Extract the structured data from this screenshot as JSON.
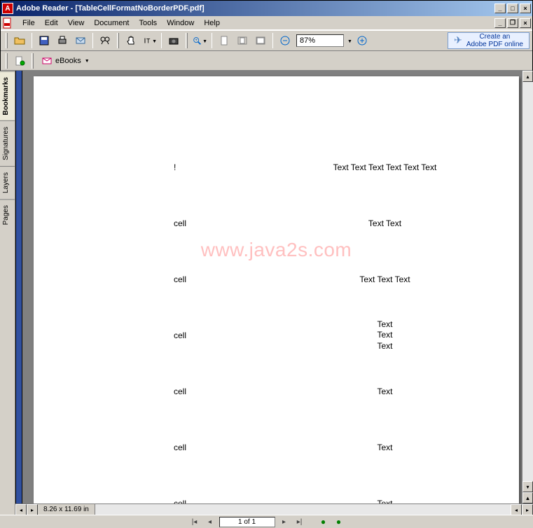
{
  "titlebar": {
    "app_name": "Adobe Reader",
    "doc_name": "[TableCellFormatNoBorderPDF.pdf]"
  },
  "menu": {
    "items": [
      "File",
      "Edit",
      "View",
      "Document",
      "Tools",
      "Window",
      "Help"
    ]
  },
  "toolbar": {
    "zoom_value": "87%",
    "ad_line1": "Create an",
    "ad_line2": "Adobe PDF online",
    "ebooks_label": "eBooks"
  },
  "sidebar": {
    "tabs": [
      "Bookmarks",
      "Signatures",
      "Layers",
      "Pages"
    ],
    "active": 0
  },
  "document": {
    "watermark": "www.java2s.com",
    "rows": [
      {
        "left": "!",
        "right": "Text Text Text Text Text Text"
      },
      {
        "left": "cell",
        "right": "Text Text"
      },
      {
        "left": "cell",
        "right": "Text Text Text"
      },
      {
        "left": "cell",
        "right_lines": [
          "Text",
          "Text",
          "Text"
        ]
      },
      {
        "left": "cell",
        "right": "Text"
      },
      {
        "left": "cell",
        "right": "Text"
      },
      {
        "left": "cell",
        "right": "Text"
      }
    ]
  },
  "status": {
    "dimensions": "8.26 x 11.69 in",
    "page_info": "1 of 1"
  }
}
